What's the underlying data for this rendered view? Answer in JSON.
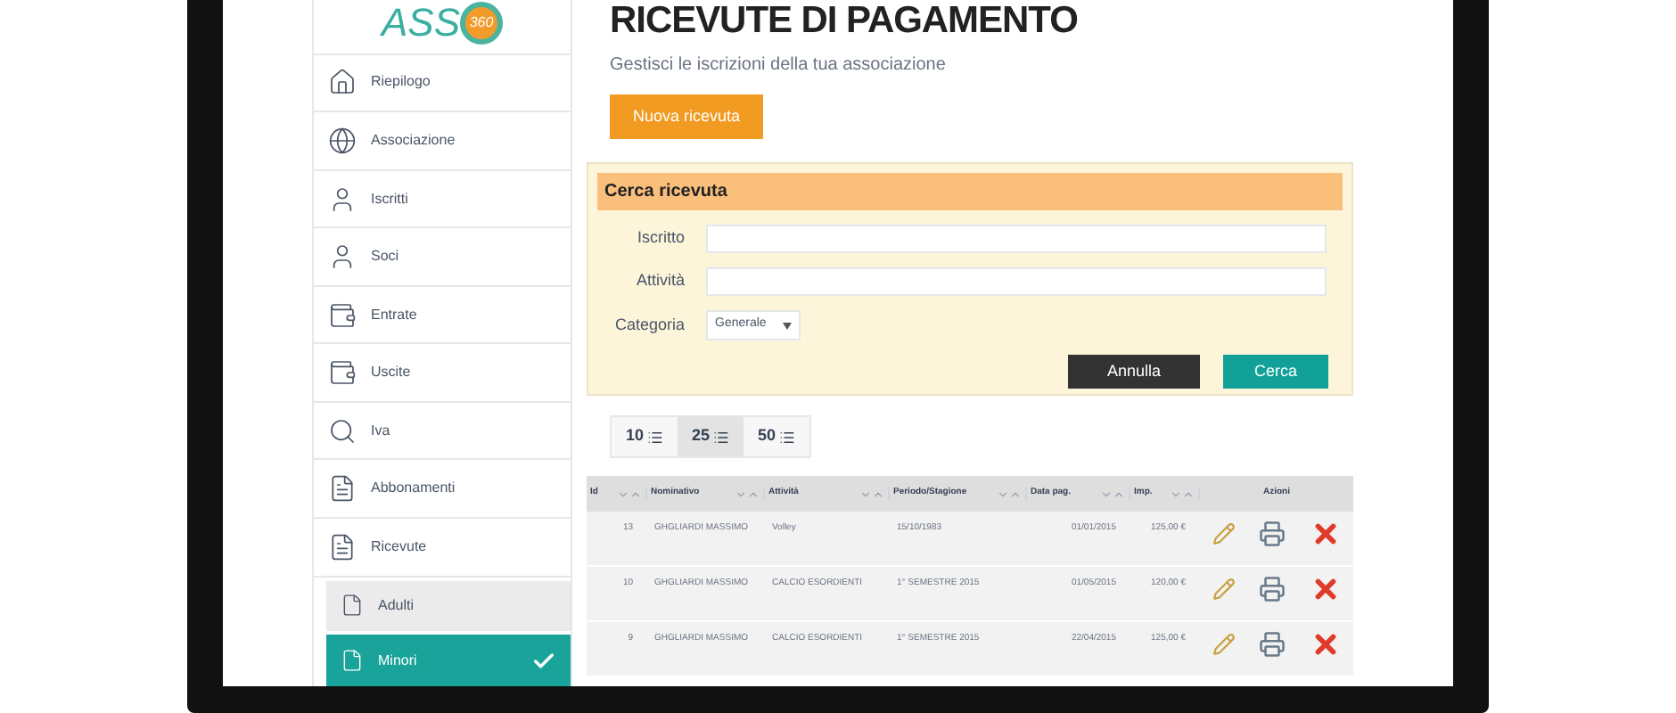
{
  "logo": {
    "text": "ASS",
    "badge": "360"
  },
  "sidebar": {
    "items": [
      {
        "label": "Riepilogo",
        "selected": false
      },
      {
        "label": "Associazione",
        "selected": false
      },
      {
        "label": "Iscritti",
        "selected": false
      },
      {
        "label": "Soci",
        "selected": false
      },
      {
        "label": "Entrate",
        "selected": false
      },
      {
        "label": "Uscite",
        "selected": false
      },
      {
        "label": "Iva",
        "selected": false
      },
      {
        "label": "Abbonamenti",
        "selected": false
      },
      {
        "label": "Ricevute",
        "selected": false,
        "expanded": true,
        "children": [
          {
            "label": "Adulti",
            "selected": false
          },
          {
            "label": "Minori",
            "selected": true
          }
        ]
      }
    ]
  },
  "page": {
    "title": "RICEVUTE DI PAGAMENTO",
    "subtitle": "Gestisci le iscrizioni della tua associazione",
    "new_button": "Nuova ricevuta"
  },
  "search": {
    "title": "Cerca ricevuta",
    "fields": [
      {
        "label": "Iscritto",
        "kind": "text"
      },
      {
        "label": "Attività",
        "kind": "text"
      },
      {
        "label": "Categoria",
        "kind": "select",
        "value": "Generale"
      }
    ],
    "cancel": "Annulla",
    "submit": "Cerca"
  },
  "page_sizes": [
    {
      "label": "10",
      "selected": false
    },
    {
      "label": "25",
      "selected": true
    },
    {
      "label": "50",
      "selected": false
    }
  ],
  "table": {
    "columns": [
      "Id",
      "Nominativo",
      "Attività",
      "Periodo/Stagione",
      "Data pag.",
      "Imp."
    ],
    "actions_column": "Azioni",
    "rows": [
      [
        "13",
        "GHGLIARDI MASSIMO",
        "Volley",
        "15/10/1983",
        "01/01/2015",
        "125,00 €"
      ],
      [
        "10",
        "GHGLIARDI MASSIMO",
        "CALCIO ESORDIENTI",
        "1° SEMESTRE 2015",
        "01/05/2015",
        "120,00 €"
      ],
      [
        "9",
        "GHGLIARDI MASSIMO",
        "CALCIO ESORDIENTI",
        "1° SEMESTRE 2015",
        "22/04/2015",
        "125,00 €"
      ]
    ]
  }
}
